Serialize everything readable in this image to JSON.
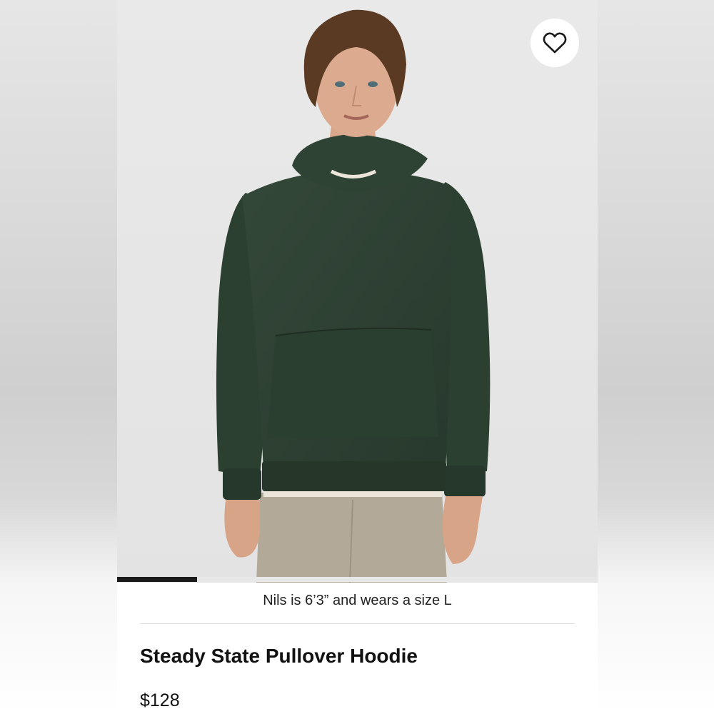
{
  "product": {
    "image_alt": "Model wearing dark green pullover hoodie",
    "fit_note": "Nils is 6’3” and wears a size L",
    "title": "Steady State Pullover Hoodie",
    "price": "$128",
    "hoodie_color": "#2f4334",
    "pants_color": "#b5ab9c"
  },
  "gallery": {
    "progress_fraction": 0.167
  },
  "icons": {
    "wishlist": "heart-outline-icon"
  }
}
